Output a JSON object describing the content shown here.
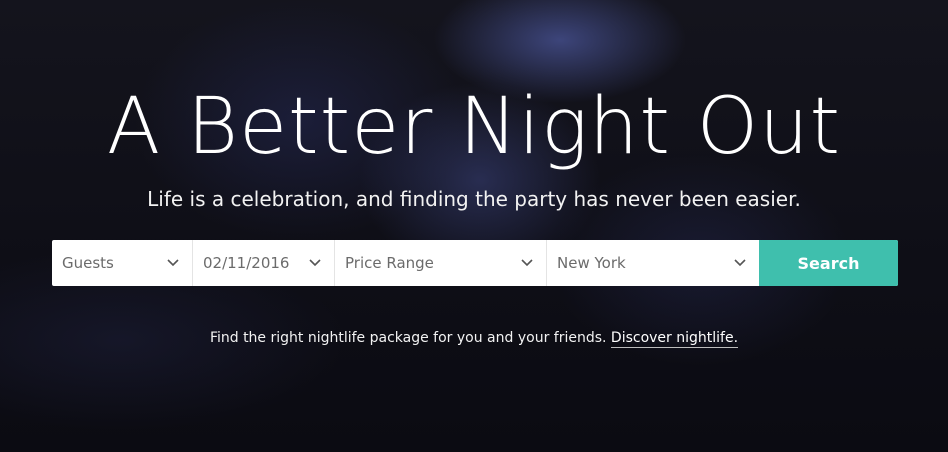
{
  "hero": {
    "title": "A Better Night Out",
    "subtitle": "Life is a celebration, and finding the party has never been easier."
  },
  "search": {
    "fields": [
      {
        "name": "guests",
        "value": "Guests"
      },
      {
        "name": "date",
        "value": "02/11/2016"
      },
      {
        "name": "price",
        "value": "Price Range"
      },
      {
        "name": "city",
        "value": "New York"
      }
    ],
    "button_label": "Search"
  },
  "tagline": {
    "text": "Find the right nightlife package for you and your friends.",
    "link_label": "Discover nightlife."
  },
  "colors": {
    "accent": "#3fbfad",
    "background": "#0e0e16",
    "field_text": "#6b6b6b"
  },
  "icons": {
    "dropdown": "chevron-down-icon"
  }
}
